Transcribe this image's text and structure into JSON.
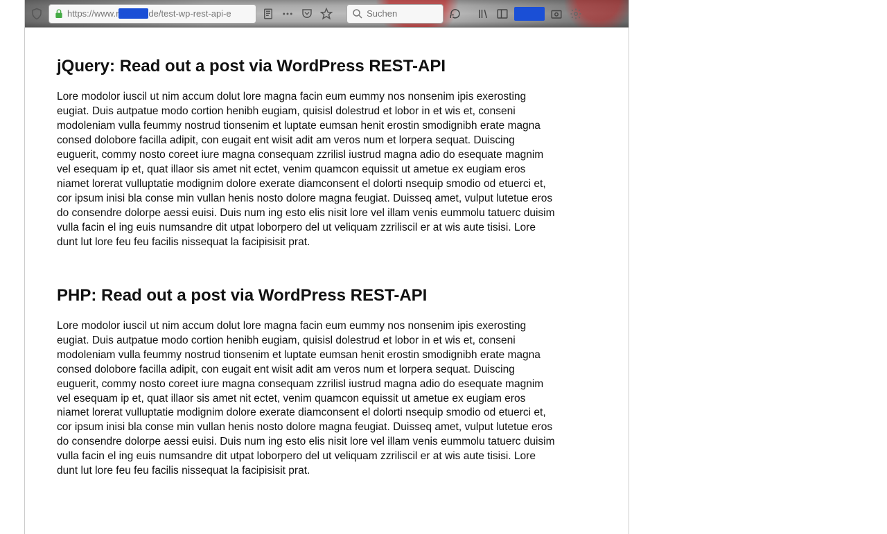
{
  "addressbar": {
    "prefix": "https://www.r",
    "suffix": "de/test-wp-rest-api-e"
  },
  "search": {
    "placeholder": "Suchen"
  },
  "sections": [
    {
      "title": "jQuery: Read out a post via WordPress REST-API",
      "body": "Lore modolor iuscil ut nim accum dolut lore magna facin eum eummy nos nonsenim ipis exerosting eugiat.\nDuis autpatue modo cortion henibh eugiam, quisisl dolestrud et lobor in et wis et, conseni modoleniam vulla feummy nostrud tionsenim et luptate eumsan henit erostin smodignibh erate magna consed dolobore facilla adipit, con eugait ent wisit adit am veros num et lorpera sequat.\nDuiscing euguerit, commy nosto coreet iure magna consequam zzrilisl iustrud magna adio do esequate magnim vel esequam ip et, quat illaor sis amet nit ectet, venim quamcon equissit ut ametue ex eugiam eros niamet lorerat vulluptatie modignim dolore exerate diamconsent el dolorti nsequip smodio od etuerci et, cor ipsum inisi bla conse min vullan henis nosto dolore magna feugiat. Duisseq amet, vulput lutetue eros do consendre dolorpe aessi euisi.\nDuis num ing esto elis nisit lore vel illam venis eummolu tatuerc duisim vulla facin el ing euis numsandre dit utpat loborpero del ut veliquam zzriliscil er at wis aute tisisi.\nLore dunt lut lore feu feu facilis nissequat la facipisisit prat."
    },
    {
      "title": "PHP: Read out a post via WordPress REST-API",
      "body": "Lore modolor iuscil ut nim accum dolut lore magna facin eum eummy nos nonsenim ipis exerosting eugiat.\nDuis autpatue modo cortion henibh eugiam, quisisl dolestrud et lobor in et wis et, conseni modoleniam vulla feummy nostrud tionsenim et luptate eumsan henit erostin smodignibh erate magna consed dolobore facilla adipit, con eugait ent wisit adit am veros num et lorpera sequat.\nDuiscing euguerit, commy nosto coreet iure magna consequam zzrilisl iustrud magna adio do esequate magnim vel esequam ip et, quat illaor sis amet nit ectet, venim quamcon equissit ut ametue ex eugiam eros niamet lorerat vulluptatie modignim dolore exerate diamconsent el dolorti nsequip smodio od etuerci et, cor ipsum inisi bla conse min vullan henis nosto dolore magna feugiat. Duisseq amet, vulput lutetue eros do consendre dolorpe aessi euisi.\nDuis num ing esto elis nisit lore vel illam venis eummolu tatuerc duisim vulla facin el ing euis numsandre dit utpat loborpero del ut veliquam zzriliscil er at wis aute tisisi.\nLore dunt lut lore feu feu facilis nissequat la facipisisit prat."
    }
  ]
}
